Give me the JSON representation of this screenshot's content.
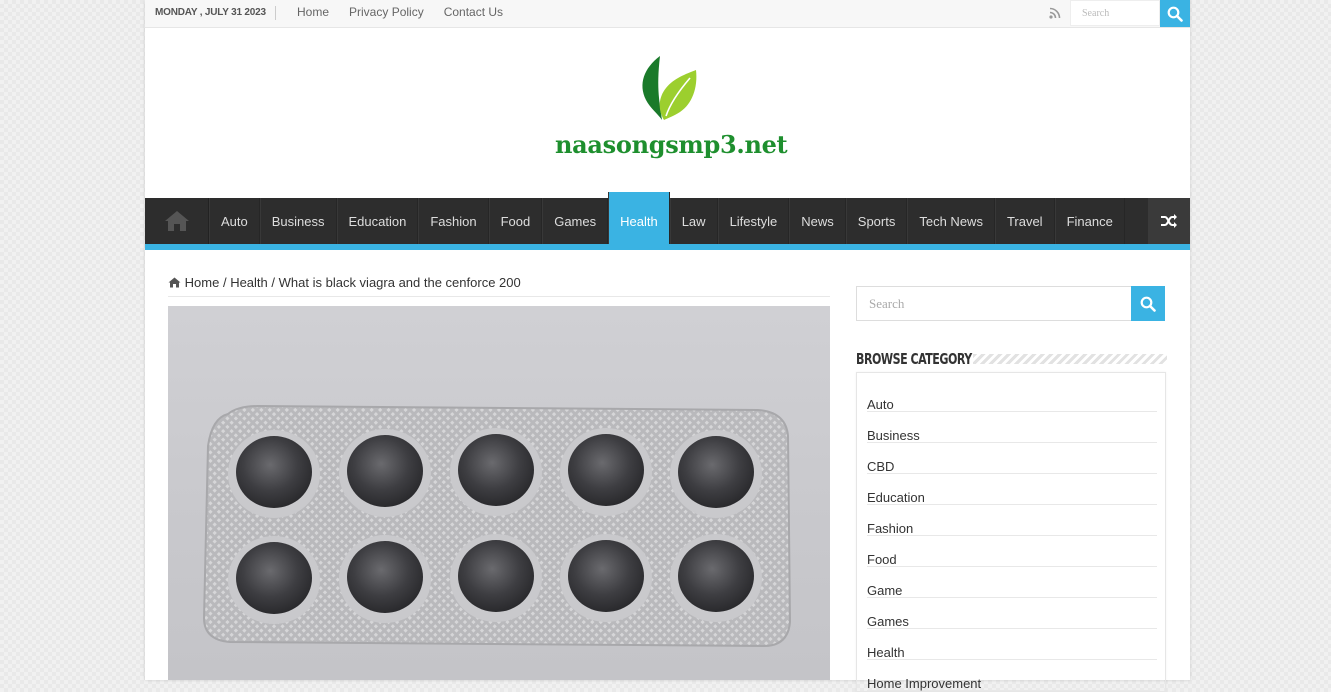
{
  "topbar": {
    "date": "MONDAY , JULY 31 2023",
    "links": [
      "Home",
      "Privacy Policy",
      "Contact Us"
    ],
    "search_placeholder": "Search"
  },
  "logo": {
    "text": "naasongsmp3.net"
  },
  "nav": {
    "items": [
      "Auto",
      "Business",
      "Education",
      "Fashion",
      "Food",
      "Games",
      "Health",
      "Law",
      "Lifestyle",
      "News",
      "Sports",
      "Tech News",
      "Travel",
      "Finance"
    ],
    "active": "Health"
  },
  "breadcrumb": {
    "home": "Home",
    "sep1": "/",
    "category": "Health",
    "sep2": "/",
    "current": "What is black viagra and the cenforce 200"
  },
  "sidebar": {
    "search_placeholder": "Search",
    "widget_title": "Browse Category",
    "categories": [
      "Auto",
      "Business",
      "CBD",
      "Education",
      "Fashion",
      "Food",
      "Game",
      "Games",
      "Health",
      "Home Improvement"
    ]
  },
  "colors": {
    "accent": "#3ab3e3",
    "nav_bg": "#2d2d2d",
    "logo_green": "#1e8f2e"
  },
  "icons": {
    "home": "home-icon",
    "rss": "rss-icon",
    "search": "search-icon",
    "shuffle": "shuffle-icon"
  }
}
